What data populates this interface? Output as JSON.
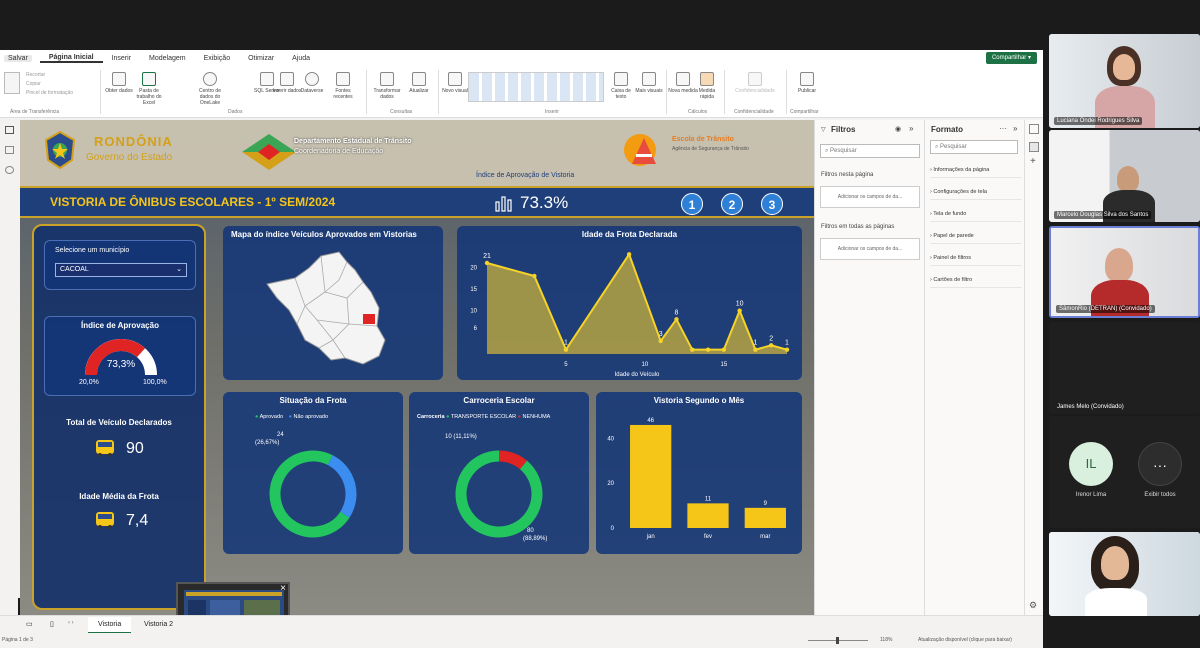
{
  "app": {
    "save_tooltip": "Salvar",
    "menu": [
      "Página Inicial",
      "Inserir",
      "Modelagem",
      "Exibição",
      "Otimizar",
      "Ajuda"
    ],
    "share_label": "Compartilhar",
    "ribbon": {
      "clipboard": [
        "Recortar",
        "Copiar",
        "Pincel de formatação"
      ],
      "clipboard_group": "Área de Transferência",
      "data_buttons": [
        "Obter dados",
        "Pasta de trabalho do Excel",
        "Centro de dados do OneLake",
        "SQL Server",
        "Inserir dados",
        "Dataverse",
        "Fontes recentes"
      ],
      "data_group": "Dados",
      "queries_buttons": [
        "Transformar dados",
        "Atualizar"
      ],
      "queries_group": "Consultas",
      "insert_buttons": [
        "Novo visual",
        "Caixa de texto",
        "Mais visuais"
      ],
      "insert_group": "Inserir",
      "calc_buttons": [
        "Nova medida",
        "Medida rápida"
      ],
      "calc_group": "Cálculos",
      "sens_button": "Confidencialidade",
      "sens_group": "Confidencialidade",
      "publish_button": "Publicar",
      "publish_group": "Compartilhar"
    },
    "tabs": [
      "Vistoria",
      "Vistoria 2"
    ],
    "status_left": "Página 1 de 3",
    "zoom": "118%",
    "status_right": "Atualização disponível (clique para baixar)"
  },
  "report": {
    "logo_line1": "RONDÔNIA",
    "logo_line2": "Governo do Estado",
    "detran_line1": "Departamento Estadual de Trânsito",
    "detran_line2": "Coordenadoria de Educação",
    "right_logo": "Escola de Trânsito",
    "right_logo_sub": "Agência de Segurança de Trânsito",
    "kpi_caption": "Índice de Aprovação de Vistoria",
    "title": "VISTORIA DE ÔNIBUS ESCOLARES - 1º SEM/2024",
    "kpi_value": "73.3%",
    "nav_buttons": [
      "1",
      "2",
      "3"
    ],
    "municipio_label": "Selecione um município",
    "municipio_value": "CACOAL",
    "gauge_title": "Índice de Aprovação",
    "gauge_value": "73,3%",
    "gauge_value_num": 73.3,
    "gauge_min": "20,0%",
    "gauge_max": "100,0%",
    "total_label": "Total de Veículo Declarados",
    "total_value": "90",
    "age_label": "Idade Média da Frota",
    "age_value": "7,4",
    "map_title": "Mapa do índice Veículos Aprovados em Vistorias",
    "pie1_title": "Situação da Frota",
    "pie1_legend": [
      "Aprovado",
      "Não aprovado"
    ],
    "pie1_label": "24",
    "pie1_label2": "(26,67%)",
    "pie2_title": "Carroceria Escolar",
    "pie2_legend_head": "Carroceria",
    "pie2_legend": [
      "TRANSPORTE ESCOLAR",
      "NENHUMA"
    ],
    "pie2_label_top": "10 (11,11%)",
    "pie2_label_bottom": "80",
    "pie2_label_bottom2": "(88,89%)",
    "colors": {
      "green": "#22c55e",
      "blue": "#3b8df0",
      "red": "#e02424",
      "yellow": "#f5c518",
      "navy": "#1f3f7a"
    }
  },
  "chart_data": [
    {
      "type": "area",
      "title": "Idade da Frota Declarada",
      "xlabel": "Idade do Veículo",
      "ylabel": "",
      "x": [
        0,
        3,
        5,
        9,
        11,
        12,
        13,
        14,
        15,
        16,
        17,
        18,
        19
      ],
      "values": [
        21,
        18,
        1,
        23,
        3,
        8,
        1,
        1,
        1,
        10,
        1,
        2,
        1
      ],
      "value_labels": [
        "21",
        "",
        "1",
        "",
        "3",
        "8",
        "",
        "",
        "",
        "10",
        "1",
        "2",
        "1"
      ],
      "x_ticks": [
        "5",
        "10",
        "15"
      ],
      "y_ticks": [
        "6",
        "10",
        "15",
        "20"
      ],
      "ylim": [
        0,
        24
      ]
    },
    {
      "type": "pie",
      "title": "Situação da Frota",
      "categories": [
        "Aprovado",
        "Não aprovado"
      ],
      "values": [
        66,
        24
      ]
    },
    {
      "type": "pie",
      "title": "Carroceria Escolar",
      "categories": [
        "TRANSPORTE ESCOLAR",
        "NENHUMA"
      ],
      "values": [
        80,
        10
      ]
    },
    {
      "type": "bar",
      "title": "Vistoria Segundo o Mês",
      "categories": [
        "jan",
        "fev",
        "mar"
      ],
      "values": [
        46,
        11,
        9
      ],
      "y_ticks": [
        "0",
        "20",
        "40"
      ],
      "ylim": [
        0,
        50
      ]
    }
  ],
  "panes": {
    "filters_title": "Filtros",
    "filters_search": "Pesquisar",
    "filters_this_page": "Filtros nesta página",
    "filters_add": "Adicionar os campos de da...",
    "filters_all_pages": "Filtros em todas as páginas",
    "filters_add2": "Adicionar os campos de da...",
    "format_title": "Formato",
    "format_search": "Pesquisar",
    "format_items": [
      "Informações da página",
      "Configurações de tela",
      "Tela de fundo",
      "Papel de parede",
      "Painel de filtros",
      "Cartões de filtro"
    ]
  },
  "teams": {
    "participants": [
      "Luciana Ondei Rodrigues Silva",
      "Marcelo Douglas Silva dos Santos",
      "SâmonRio (DETRAN) (Convidado)",
      "James Melo (Convidado)"
    ],
    "ireneu_initials": "IL",
    "ireneu_name": "Irenor Lima",
    "more_label": "Exibir todos",
    "more_icon": "···"
  }
}
